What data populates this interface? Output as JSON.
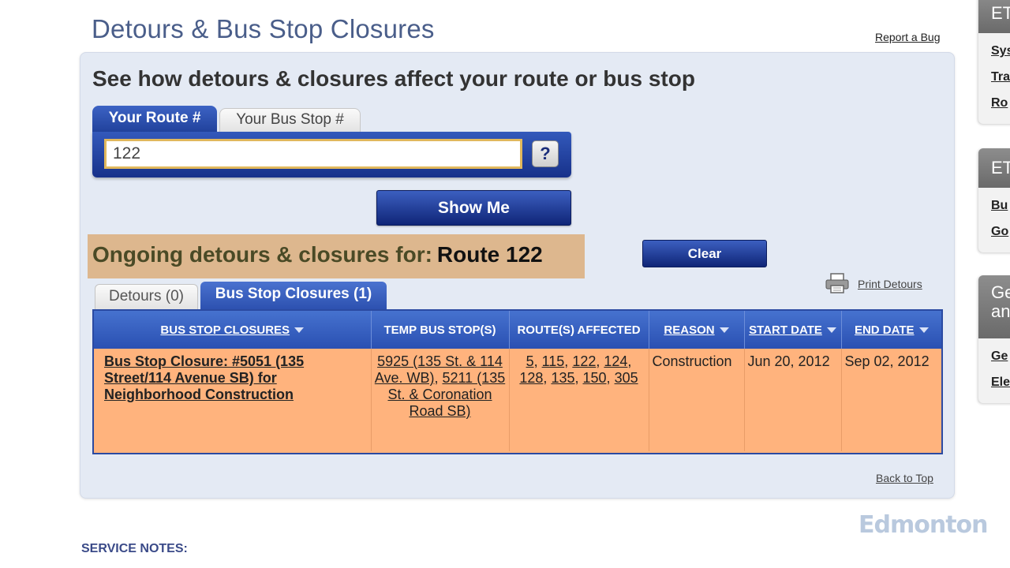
{
  "header": {
    "title": "Detours & Bus Stop Closures",
    "report_bug": "Report a Bug"
  },
  "search": {
    "heading": "See how detours & closures affect your route or bus stop",
    "tab_route": "Your Route #",
    "tab_stop": "Your Bus Stop #",
    "route_value": "122",
    "help_symbol": "?",
    "show_me": "Show Me"
  },
  "results": {
    "ongoing_label": "Ongoing detours & closures for:",
    "route_label": "Route 122",
    "clear": "Clear",
    "print": "Print Detours",
    "tab_detours": "Detours (0)",
    "tab_closures": "Bus Stop Closures (1)"
  },
  "table": {
    "headers": [
      "BUS STOP CLOSURES",
      "TEMP BUS STOP(S)",
      "ROUTE(S) AFFECTED",
      "REASON",
      "START DATE",
      "END DATE"
    ],
    "rows": [
      {
        "closure": "Bus Stop Closure: #5051 (135 Street/114 Avenue SB) for Neighborhood Construction",
        "temp_stop_1": "5925 (135 St. & 114 Ave. WB)",
        "temp_stop_2": "5211 (135 St. & Coronation Road SB)",
        "routes": [
          "5",
          "115",
          "122",
          "124",
          "128",
          "135",
          "150",
          "305"
        ],
        "reason": "Construction",
        "start_date": "Jun 20, 2012",
        "end_date": "Sep 02, 2012"
      }
    ]
  },
  "footer": {
    "back_to_top": "Back to Top",
    "logo_text": "Edmonton",
    "service_notes": "SERVICE NOTES:"
  },
  "sidebar": {
    "box1_title": "ET",
    "box1_links": [
      "Sys",
      "Tra",
      "Ro"
    ],
    "box2_title": "ET",
    "box2_links": [
      "Bu",
      "Go"
    ],
    "box3_title_1": "Ge",
    "box3_title_2": "an",
    "box3_links": [
      "Ge",
      "Ele"
    ]
  },
  "colors": {
    "accent_blue": "#2a50b2",
    "row_orange": "#ffb37d",
    "ongoing_bg": "#ddb78e",
    "panel_bg": "#e4eaf4",
    "title_color": "#4a5e8a"
  }
}
